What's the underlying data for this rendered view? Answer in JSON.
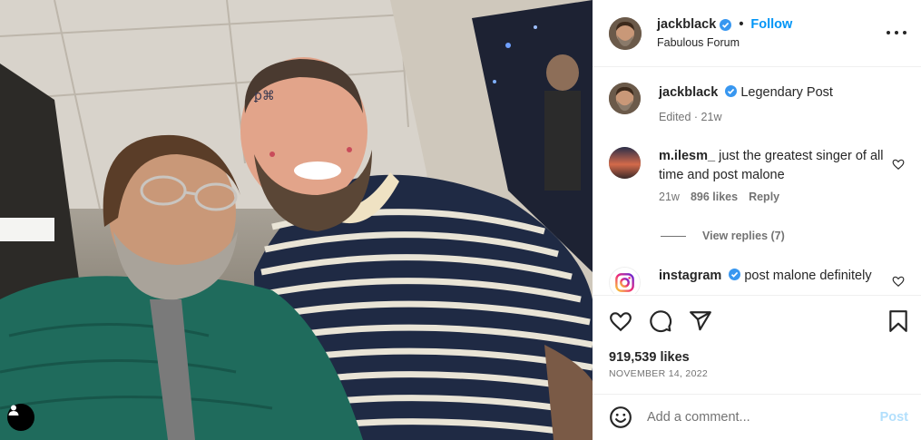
{
  "header": {
    "username": "jackblack",
    "verified_icon": "verified-badge-icon",
    "separator": "•",
    "follow_label": "Follow",
    "location": "Fabulous Forum",
    "more_icon": "more-options-icon"
  },
  "caption": {
    "username": "jackblack",
    "text": "Legendary Post",
    "meta": "Edited · 21w"
  },
  "comments": [
    {
      "username": "m.ilesm_",
      "text": "just the greatest singer of all time and post malone",
      "age": "21w",
      "likes": "896 likes",
      "reply_label": "Reply",
      "view_replies": "View replies (7)"
    },
    {
      "username": "instagram",
      "text": "post malone definitely"
    }
  ],
  "actions": {
    "like_icon": "heart-icon",
    "comment_icon": "comment-icon",
    "share_icon": "share-icon",
    "save_icon": "bookmark-icon"
  },
  "likes": "919,539 likes",
  "date": "NOVEMBER 14, 2022",
  "add_comment": {
    "placeholder": "Add a comment...",
    "post_label": "Post",
    "emoji_icon": "emoji-icon"
  },
  "photo": {
    "user_tag_icon": "user-tag-icon"
  },
  "colors": {
    "accent": "#0095f6",
    "post_disabled": "#b2dffc",
    "verified": "#3897f0"
  }
}
